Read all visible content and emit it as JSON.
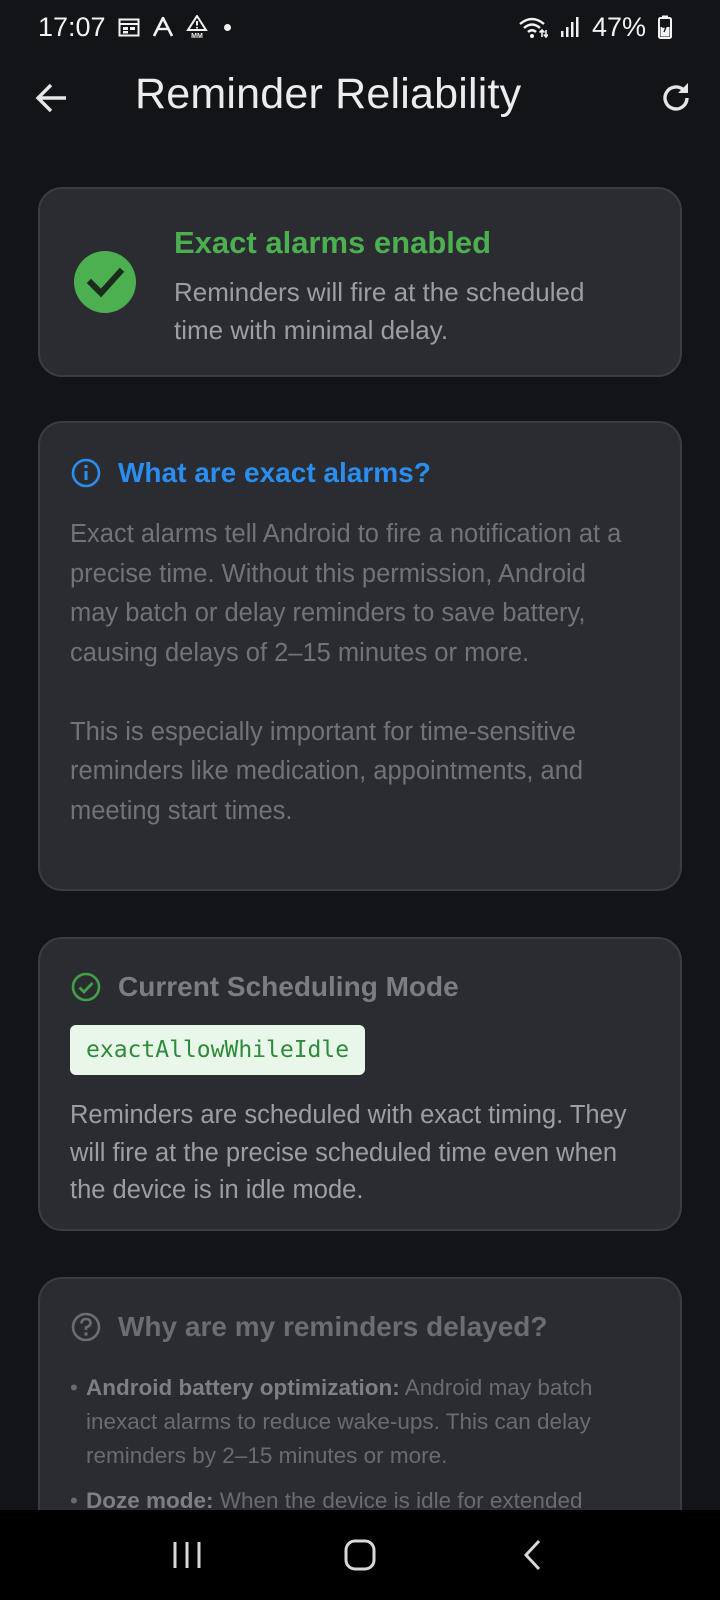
{
  "status_bar": {
    "time": "17:07",
    "battery": "47%",
    "icons": [
      "calendar-icon",
      "font-a-icon",
      "alert-mm-icon",
      "wifi-icon",
      "signal-icon",
      "battery-icon"
    ]
  },
  "app_bar": {
    "title": "Reminder Reliability",
    "back_icon": "arrow-left-icon",
    "refresh_icon": "refresh-icon"
  },
  "status_card": {
    "title": "Exact alarms enabled",
    "description": "Reminders will fire at the scheduled time with minimal delay.",
    "icon": "check-circle-icon",
    "accent": "#4caf50"
  },
  "info_card": {
    "title": "What are exact alarms?",
    "icon": "info-icon",
    "accent": "#2a8ef0",
    "paragraphs": [
      "Exact alarms tell Android to fire a notification at a precise time. Without this permission, Android may batch or delay reminders to save battery, causing delays of 2–15 minutes or more.",
      "This is especially important for time-sensitive reminders like medication, appointments, and meeting start times."
    ]
  },
  "mode_card": {
    "title": "Current Scheduling Mode",
    "icon": "check-circle-outline-icon",
    "mode_value": "exactAllowWhileIdle",
    "description": "Reminders are scheduled with exact timing. They will fire at the precise scheduled time even when the device is in idle mode."
  },
  "why_card": {
    "title": "Why are my reminders delayed?",
    "icon": "help-circle-icon",
    "items": [
      {
        "term": "Android battery optimization:",
        "text": " Android may batch inexact alarms to reduce wake-ups. This can delay reminders by 2–15 minutes or more."
      },
      {
        "term": "Doze mode:",
        "text": " When the device is idle for extended"
      }
    ]
  },
  "nav_bar": {
    "icons": [
      "recents-icon",
      "home-icon",
      "back-icon"
    ]
  }
}
